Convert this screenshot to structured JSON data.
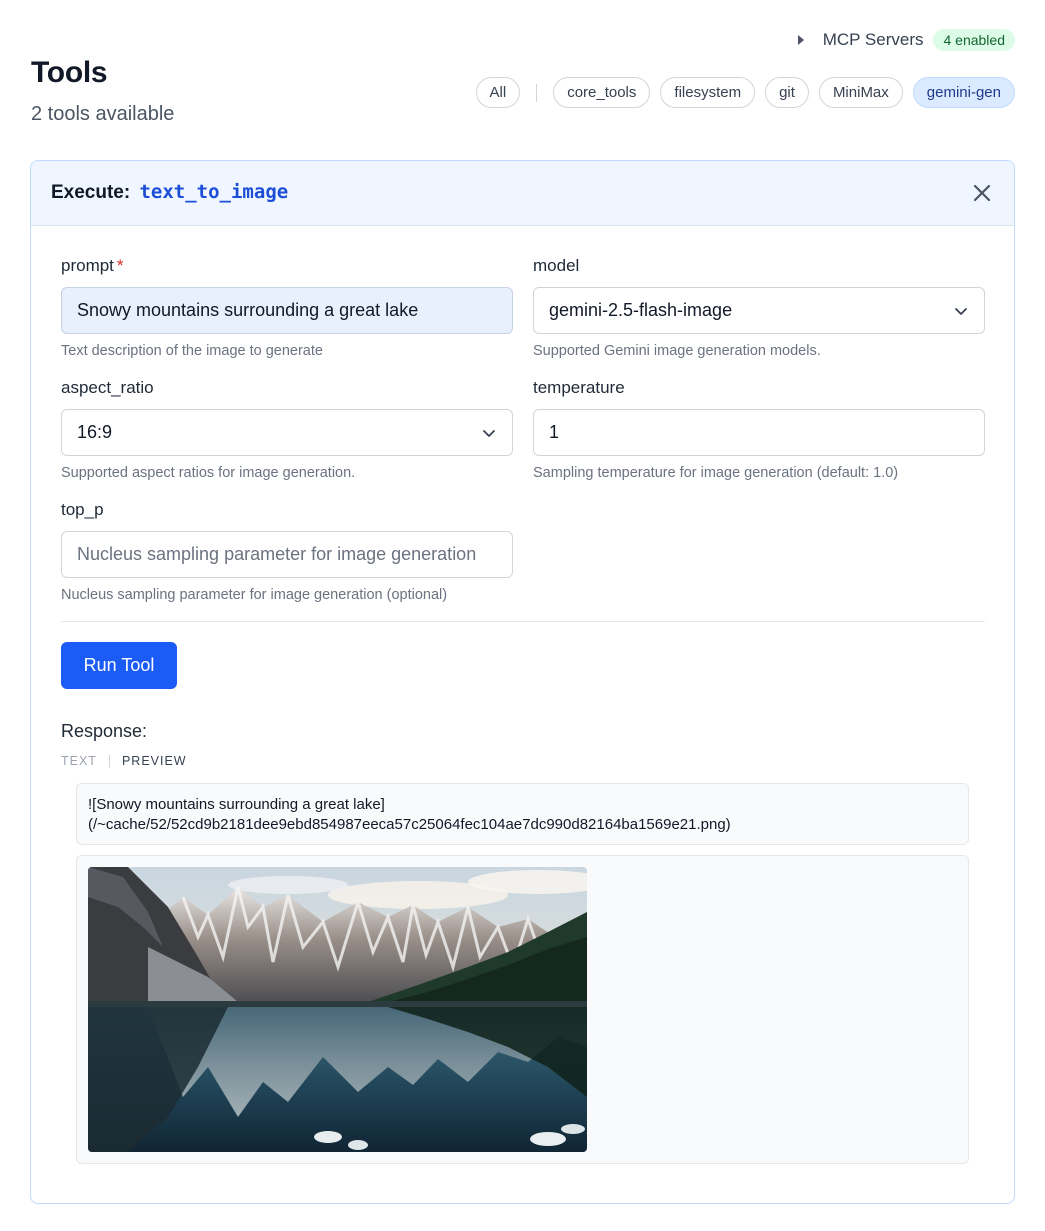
{
  "header": {
    "title": "Tools",
    "subtitle": "2 tools available",
    "mcp_label": "MCP Servers",
    "mcp_badge": "4 enabled",
    "filters": [
      "All",
      "core_tools",
      "filesystem",
      "git",
      "MiniMax",
      "gemini-gen"
    ],
    "active_filter": "gemini-gen"
  },
  "execute": {
    "prefix": "Execute:",
    "tool_name": "text_to_image"
  },
  "fields": {
    "prompt": {
      "label": "prompt",
      "required_mark": "*",
      "value": "Snowy mountains surrounding a great lake",
      "help": "Text description of the image to generate"
    },
    "model": {
      "label": "model",
      "value": "gemini-2.5-flash-image",
      "help": "Supported Gemini image generation models."
    },
    "aspect_ratio": {
      "label": "aspect_ratio",
      "value": "16:9",
      "help": "Supported aspect ratios for image generation."
    },
    "temperature": {
      "label": "temperature",
      "value": "1",
      "help": "Sampling temperature for image generation (default: 1.0)"
    },
    "top_p": {
      "label": "top_p",
      "placeholder": "Nucleus sampling parameter for image generation",
      "help": "Nucleus sampling parameter for image generation (optional)"
    }
  },
  "run_button": "Run Tool",
  "response": {
    "label": "Response:",
    "tab_text": "TEXT",
    "tab_preview": "PREVIEW",
    "text_line1": "![Snowy mountains surrounding a great lake]",
    "text_line2": "(/~cache/52/52cd9b2181dee9ebd854987eeca57c25064fec104ae7dc990d82164ba1569e21.png)"
  },
  "colors": {
    "accent": "#1a5cf5",
    "badge_bg": "#dcfce7",
    "badge_text": "#166534",
    "panel_header_bg": "#eff6ff",
    "required": "#dc2626"
  },
  "icons": {
    "mcp_toggle": "caret-right-icon",
    "close": "close-icon",
    "select": "chevron-down-icon"
  }
}
